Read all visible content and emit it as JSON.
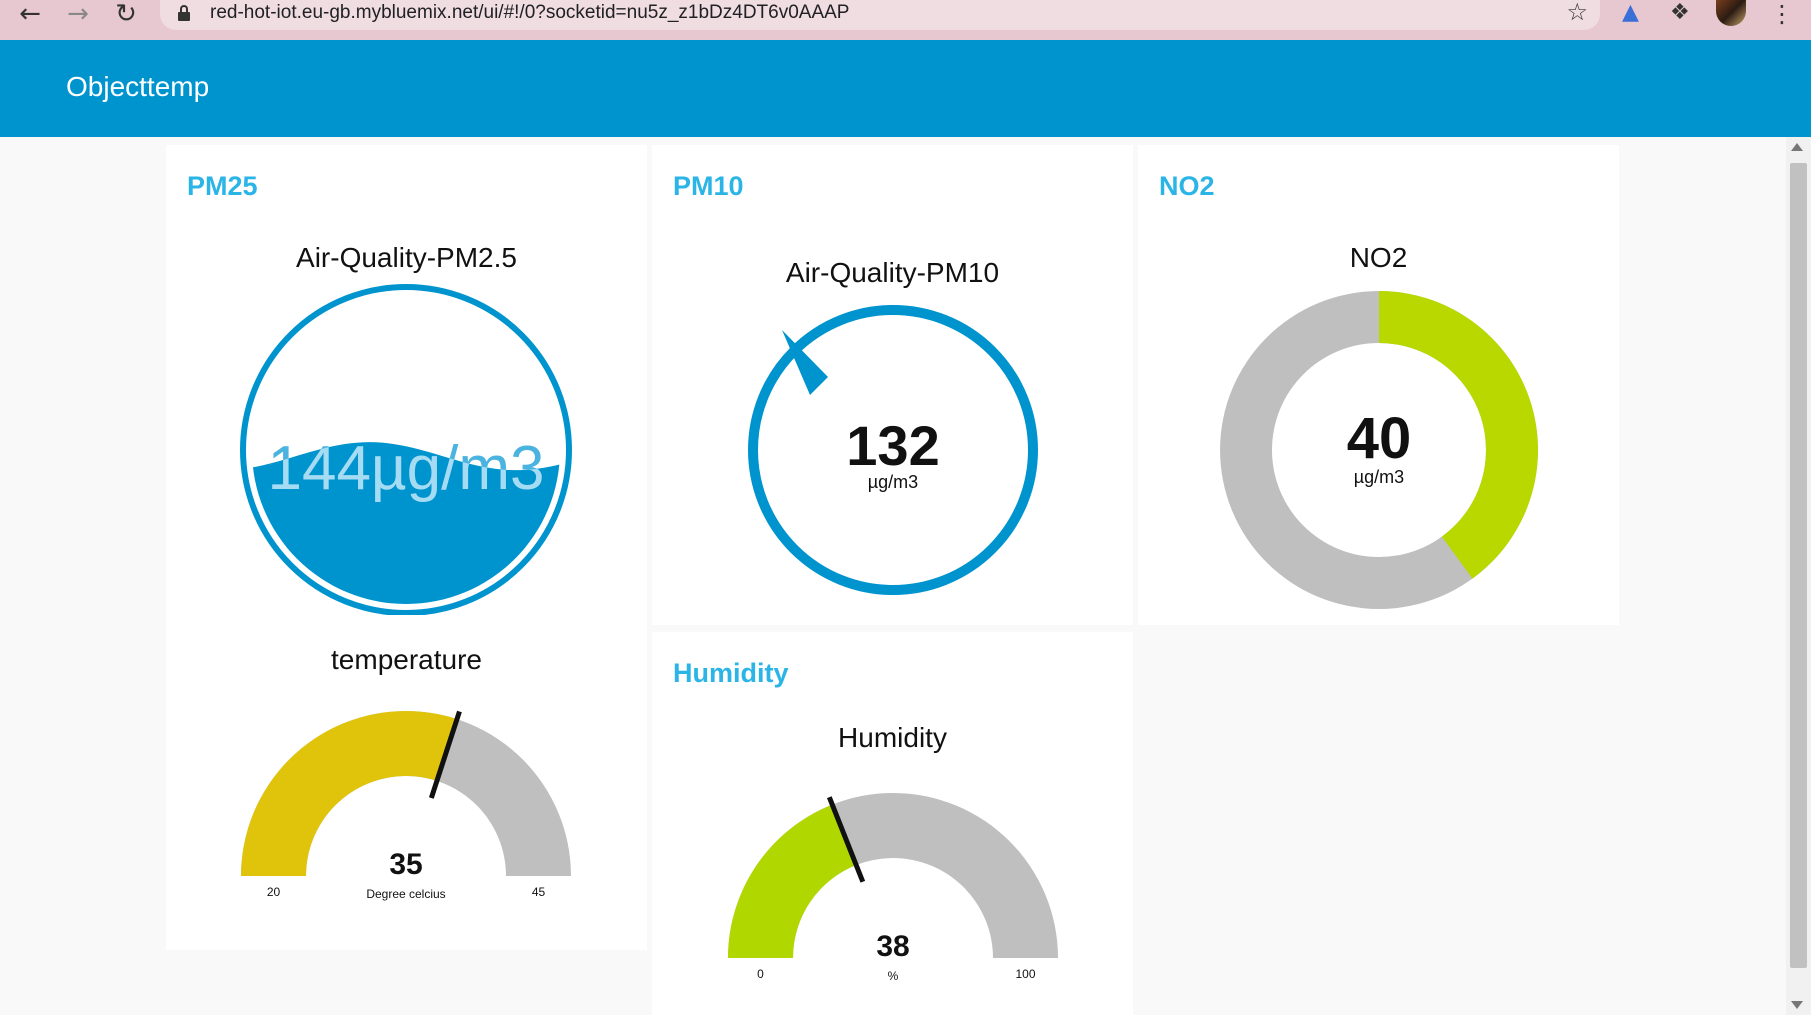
{
  "browser": {
    "url": "red-hot-iot.eu-gb.mybluemix.net/ui/#!/0?socketid=nu5z_z1bDz4DT6v0AAAP"
  },
  "toolbar": {
    "title": "Objecttemp"
  },
  "groups": {
    "pm25": {
      "title": "PM25",
      "liquid": {
        "label": "Air-Quality-PM2.5",
        "value": 144,
        "unit": "µg/m3",
        "display": "144µg/m3",
        "level_pct": 48,
        "color": "#0094ce"
      },
      "temperature": {
        "label": "temperature",
        "value": 35,
        "display": "35",
        "min": 20,
        "max": 45,
        "min_label": "20",
        "max_label": "45",
        "units": "Degree celcius",
        "color": "#e0c40c",
        "track_color": "#bfbfbf"
      }
    },
    "pm10": {
      "title": "PM10",
      "compass": {
        "label": "Air-Quality-PM10",
        "value": 132,
        "display": "132",
        "unit": "µg/m3",
        "color": "#0094ce"
      }
    },
    "no2": {
      "title": "NO2",
      "donut": {
        "label": "NO2",
        "value": 40,
        "display": "40",
        "unit": "µg/m3",
        "min": 0,
        "max": 100,
        "color": "#b8d800",
        "track_color": "#bfbfbf"
      }
    },
    "humidity": {
      "title": "Humidity",
      "gauge": {
        "label": "Humidity",
        "value": 38,
        "display": "38",
        "min": 0,
        "max": 100,
        "min_label": "0",
        "max_label": "100",
        "units": "%",
        "color": "#b0d800",
        "track_color": "#bfbfbf"
      }
    }
  },
  "icons": {
    "back": "arrow-left-icon",
    "forward": "arrow-right-icon",
    "reload": "reload-icon",
    "lock": "lock-icon",
    "star": "star-icon",
    "extension": "puzzle-icon",
    "menu": "kebab-menu-icon"
  }
}
